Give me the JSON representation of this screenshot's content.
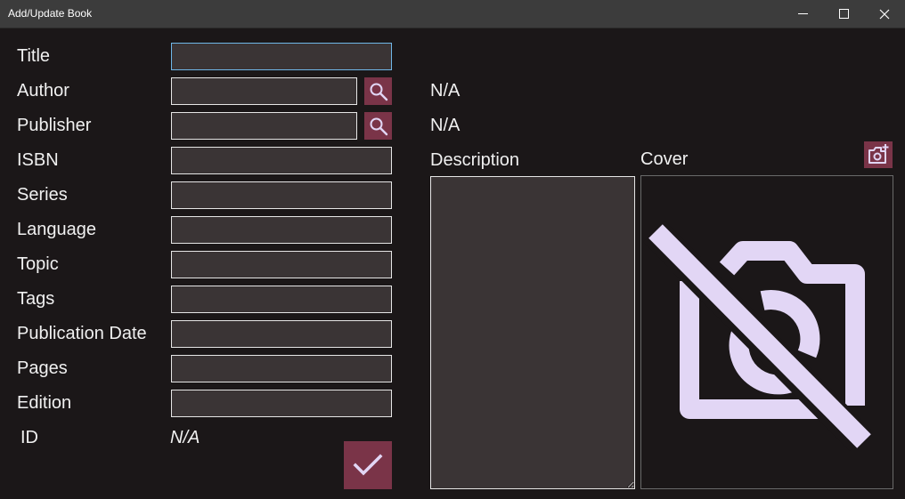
{
  "window": {
    "title": "Add/Update Book",
    "controls": [
      "minimize-icon",
      "maximize-icon",
      "close-icon"
    ]
  },
  "form": {
    "labels": {
      "title": "Title",
      "author": "Author",
      "publisher": "Publisher",
      "isbn": "ISBN",
      "series": "Series",
      "language": "Language",
      "topic": "Topic",
      "tags": "Tags",
      "publication_date": "Publication Date",
      "pages": "Pages",
      "edition": "Edition",
      "id": "ID"
    },
    "values": {
      "title": "",
      "author": "",
      "publisher": "",
      "isbn": "",
      "series": "",
      "language": "",
      "topic": "",
      "tags": "",
      "publication_date": "",
      "pages": "",
      "edition": ""
    },
    "id_value": "N/A",
    "author_selected": "N/A",
    "publisher_selected": "N/A",
    "search_icon": "search-icon",
    "submit_icon": "checkmark-icon"
  },
  "right": {
    "description_label": "Description",
    "cover_label": "Cover",
    "add_cover_icon": "add-photo-icon",
    "cover_placeholder_icon": "no-photo-icon"
  },
  "colors": {
    "background": "#1b1718",
    "titlebar": "#3c3c3c",
    "field_bg": "#3a3435",
    "accent": "#7a3448",
    "icon_light": "#e2d6f5",
    "focus_border": "#6fb7e8"
  }
}
